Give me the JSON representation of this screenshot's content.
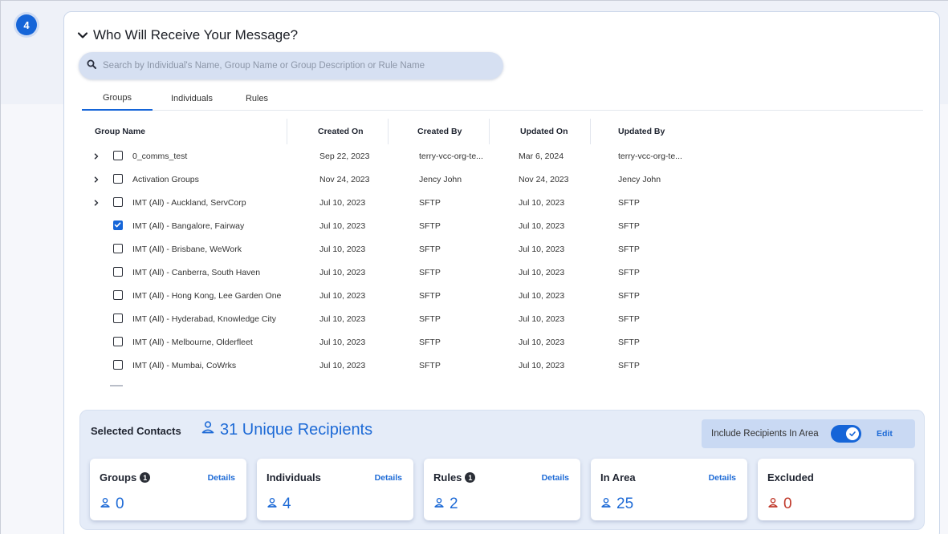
{
  "step": {
    "number": "4"
  },
  "section": {
    "title": "Who Will Receive Your Message?"
  },
  "search": {
    "placeholder": "Search by Individual's Name, Group Name or Group Description or Rule Name"
  },
  "tabs": [
    {
      "label": "Groups",
      "active": true
    },
    {
      "label": "Individuals",
      "active": false
    },
    {
      "label": "Rules",
      "active": false
    }
  ],
  "table": {
    "headers": {
      "group_name": "Group Name",
      "created_on": "Created On",
      "created_by": "Created By",
      "updated_on": "Updated On",
      "updated_by": "Updated By"
    },
    "rows": [
      {
        "expandable": true,
        "checked": false,
        "name": "0_comms_test",
        "created_on": "Sep 22, 2023",
        "created_by": "terry-vcc-org-te...",
        "updated_on": "Mar 6, 2024",
        "updated_by": "terry-vcc-org-te..."
      },
      {
        "expandable": true,
        "checked": false,
        "name": "Activation Groups",
        "created_on": "Nov 24, 2023",
        "created_by": "Jency John",
        "updated_on": "Nov 24, 2023",
        "updated_by": "Jency John"
      },
      {
        "expandable": true,
        "checked": false,
        "name": "IMT (All) - Auckland, ServCorp",
        "created_on": "Jul 10, 2023",
        "created_by": "SFTP",
        "updated_on": "Jul 10, 2023",
        "updated_by": "SFTP"
      },
      {
        "expandable": false,
        "checked": true,
        "name": "IMT (All) - Bangalore, Fairway",
        "created_on": "Jul 10, 2023",
        "created_by": "SFTP",
        "updated_on": "Jul 10, 2023",
        "updated_by": "SFTP"
      },
      {
        "expandable": false,
        "checked": false,
        "name": "IMT (All) - Brisbane, WeWork",
        "created_on": "Jul 10, 2023",
        "created_by": "SFTP",
        "updated_on": "Jul 10, 2023",
        "updated_by": "SFTP"
      },
      {
        "expandable": false,
        "checked": false,
        "name": "IMT (All) - Canberra, South Haven",
        "created_on": "Jul 10, 2023",
        "created_by": "SFTP",
        "updated_on": "Jul 10, 2023",
        "updated_by": "SFTP"
      },
      {
        "expandable": false,
        "checked": false,
        "name": "IMT (All) - Hong Kong, Lee Garden One",
        "created_on": "Jul 10, 2023",
        "created_by": "SFTP",
        "updated_on": "Jul 10, 2023",
        "updated_by": "SFTP"
      },
      {
        "expandable": false,
        "checked": false,
        "name": "IMT (All) - Hyderabad, Knowledge City",
        "created_on": "Jul 10, 2023",
        "created_by": "SFTP",
        "updated_on": "Jul 10, 2023",
        "updated_by": "SFTP"
      },
      {
        "expandable": false,
        "checked": false,
        "name": "IMT (All) - Melbourne, Olderfleet",
        "created_on": "Jul 10, 2023",
        "created_by": "SFTP",
        "updated_on": "Jul 10, 2023",
        "updated_by": "SFTP"
      },
      {
        "expandable": false,
        "checked": false,
        "name": "IMT (All) - Mumbai, CoWrks",
        "created_on": "Jul 10, 2023",
        "created_by": "SFTP",
        "updated_on": "Jul 10, 2023",
        "updated_by": "SFTP"
      }
    ]
  },
  "summary": {
    "label": "Selected Contacts",
    "unique_recipients": "31 Unique Recipients",
    "include_area_label": "Include Recipients In Area",
    "include_area_enabled": true,
    "edit_label": "Edit",
    "cards": [
      {
        "title": "Groups",
        "info": "1",
        "details": "Details",
        "value": "0",
        "tone": "blue"
      },
      {
        "title": "Individuals",
        "info": "",
        "details": "Details",
        "value": "4",
        "tone": "blue"
      },
      {
        "title": "Rules",
        "info": "1",
        "details": "Details",
        "value": "2",
        "tone": "blue"
      },
      {
        "title": "In Area",
        "info": "",
        "details": "Details",
        "value": "25",
        "tone": "blue"
      },
      {
        "title": "Excluded",
        "info": "",
        "details": "",
        "value": "0",
        "tone": "red"
      }
    ]
  },
  "colors": {
    "accent": "#1565d8",
    "link": "#1d6ad6",
    "excluded": "#c0392b"
  },
  "icons": {
    "search": "search-icon",
    "chevron": "chevron-down-icon",
    "expand": "chevron-right-icon",
    "person": "person-icon",
    "check": "check-icon",
    "info": "info-icon"
  }
}
